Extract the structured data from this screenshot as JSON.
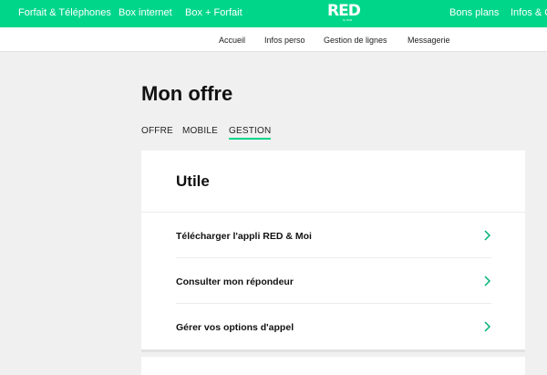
{
  "topnav": {
    "items": [
      "Forfait & Téléphones",
      "Box internet",
      "Box + Forfait"
    ],
    "right_items": [
      "Bons plans",
      "Infos & Q"
    ],
    "logo": "RED",
    "logo_sub": "by SFR"
  },
  "subnav": {
    "items": [
      "Accueil",
      "Infos perso",
      "Gestion de lignes",
      "Messagerie"
    ]
  },
  "page": {
    "title": "Mon offre",
    "tabs": [
      "OFFRE",
      "MOBILE",
      "GESTION"
    ],
    "active_tab": "GESTION"
  },
  "card": {
    "title": "Utile",
    "rows": [
      "Télécharger l'appli RED & Moi",
      "Consulter mon répondeur",
      "Gérer vos options d'appel"
    ]
  },
  "colors": {
    "brand": "#00d68a",
    "background": "#f0f0f0",
    "chevron": "#00b377"
  }
}
